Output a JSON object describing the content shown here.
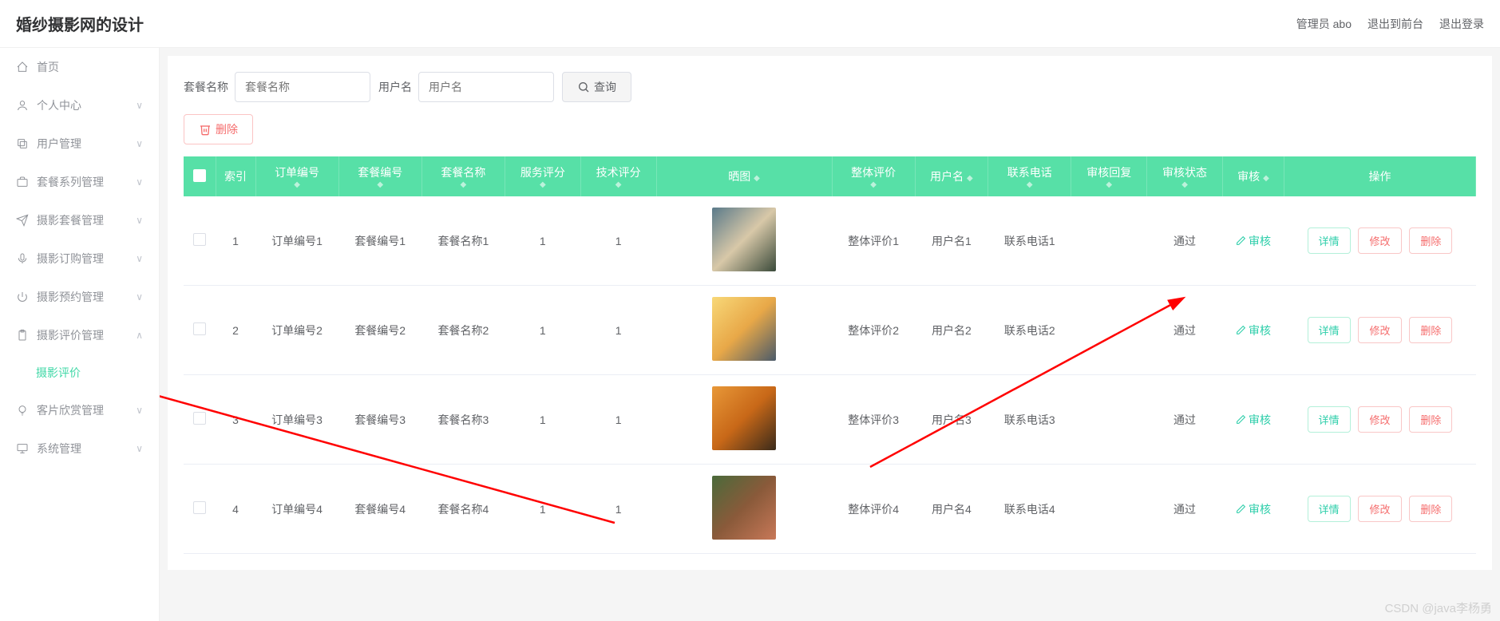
{
  "header": {
    "title": "婚纱摄影网的设计",
    "admin_label": "管理员 abo",
    "exit_front": "退出到前台",
    "logout": "退出登录"
  },
  "sidebar": {
    "items": [
      {
        "label": "首页",
        "icon": "home-icon",
        "expandable": false
      },
      {
        "label": "个人中心",
        "icon": "user-icon",
        "expandable": true
      },
      {
        "label": "用户管理",
        "icon": "copy-icon",
        "expandable": true
      },
      {
        "label": "套餐系列管理",
        "icon": "briefcase-icon",
        "expandable": true
      },
      {
        "label": "摄影套餐管理",
        "icon": "send-icon",
        "expandable": true
      },
      {
        "label": "摄影订购管理",
        "icon": "mic-icon",
        "expandable": true
      },
      {
        "label": "摄影预约管理",
        "icon": "power-icon",
        "expandable": true
      },
      {
        "label": "摄影评价管理",
        "icon": "clipboard-icon",
        "expandable": true,
        "expanded": true,
        "children": [
          {
            "label": "摄影评价"
          }
        ]
      },
      {
        "label": "客片欣赏管理",
        "icon": "bulb-icon",
        "expandable": true
      },
      {
        "label": "系统管理",
        "icon": "monitor-icon",
        "expandable": true
      }
    ]
  },
  "search": {
    "package_label": "套餐名称",
    "package_placeholder": "套餐名称",
    "user_label": "用户名",
    "user_placeholder": "用户名",
    "query_btn": "查询"
  },
  "actions": {
    "delete_btn": "删除"
  },
  "table": {
    "headers": {
      "checkbox": "",
      "index": "索引",
      "order_no": "订单编号",
      "package_no": "套餐编号",
      "package_name": "套餐名称",
      "service_score": "服务评分",
      "tech_score": "技术评分",
      "image": "晒图",
      "overall": "整体评价",
      "username": "用户名",
      "phone": "联系电话",
      "audit_reply": "审核回复",
      "audit_status": "审核状态",
      "audit": "审核",
      "ops": "操作"
    },
    "audit_label": "审核",
    "detail_btn": "详情",
    "edit_btn": "修改",
    "delete_btn": "删除",
    "rows": [
      {
        "index": "1",
        "order_no": "订单编号1",
        "package_no": "套餐编号1",
        "package_name": "套餐名称1",
        "service_score": "1",
        "tech_score": "1",
        "overall": "整体评价1",
        "username": "用户名1",
        "phone": "联系电话1",
        "audit_reply": "",
        "audit_status": "通过",
        "img_colors": [
          "#5a7a8a",
          "#d8c8a8",
          "#3a4a3a"
        ]
      },
      {
        "index": "2",
        "order_no": "订单编号2",
        "package_no": "套餐编号2",
        "package_name": "套餐名称2",
        "service_score": "1",
        "tech_score": "1",
        "overall": "整体评价2",
        "username": "用户名2",
        "phone": "联系电话2",
        "audit_reply": "",
        "audit_status": "通过",
        "img_colors": [
          "#f8d878",
          "#e8a848",
          "#4a5a6a"
        ]
      },
      {
        "index": "3",
        "order_no": "订单编号3",
        "package_no": "套餐编号3",
        "package_name": "套餐名称3",
        "service_score": "1",
        "tech_score": "1",
        "overall": "整体评价3",
        "username": "用户名3",
        "phone": "联系电话3",
        "audit_reply": "",
        "audit_status": "通过",
        "img_colors": [
          "#e89838",
          "#c86818",
          "#3a2a1a"
        ]
      },
      {
        "index": "4",
        "order_no": "订单编号4",
        "package_no": "套餐编号4",
        "package_name": "套餐名称4",
        "service_score": "1",
        "tech_score": "1",
        "overall": "整体评价4",
        "username": "用户名4",
        "phone": "联系电话4",
        "audit_reply": "",
        "audit_status": "通过",
        "img_colors": [
          "#4a6a3a",
          "#8a5a3a",
          "#c87858"
        ]
      }
    ]
  },
  "watermark": "CSDN @java李杨勇"
}
